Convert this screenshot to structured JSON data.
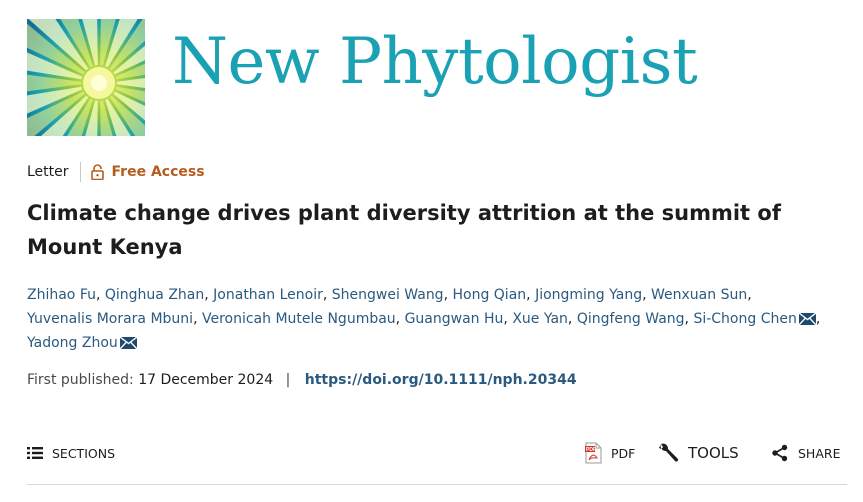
{
  "journal": {
    "name": "New Phytologist",
    "logo_icon": "sunburst-logo-icon",
    "brand_color": "#1aa1b3"
  },
  "article": {
    "type": "Letter",
    "access": "Free Access",
    "title": "Climate change drives plant diversity attrition at the summit of Mount Kenya"
  },
  "authors": [
    {
      "name": "Zhihao Fu",
      "corresponding": false
    },
    {
      "name": "Qinghua Zhan",
      "corresponding": false
    },
    {
      "name": "Jonathan Lenoir",
      "corresponding": false
    },
    {
      "name": "Shengwei Wang",
      "corresponding": false
    },
    {
      "name": "Hong Qian",
      "corresponding": false
    },
    {
      "name": "Jiongming Yang",
      "corresponding": false
    },
    {
      "name": "Wenxuan Sun",
      "corresponding": false
    },
    {
      "name": "Yuvenalis Morara Mbuni",
      "corresponding": false
    },
    {
      "name": "Veronicah Mutele Ngumbau",
      "corresponding": false
    },
    {
      "name": "Guangwan Hu",
      "corresponding": false
    },
    {
      "name": "Xue Yan",
      "corresponding": false
    },
    {
      "name": "Qingfeng Wang",
      "corresponding": false
    },
    {
      "name": "Si-Chong Chen",
      "corresponding": true
    },
    {
      "name": "Yadong Zhou",
      "corresponding": true
    }
  ],
  "publication": {
    "first_published_label": "First published:",
    "date": "17 December 2024",
    "separator": "|",
    "doi": "https://doi.org/10.1111/nph.20344"
  },
  "toolbar": {
    "sections_label": "SECTIONS",
    "pdf_label": "PDF",
    "tools_label": "TOOLS",
    "share_label": "SHARE"
  },
  "colors": {
    "access": "#b75c1e",
    "link": "#2a5a80"
  }
}
